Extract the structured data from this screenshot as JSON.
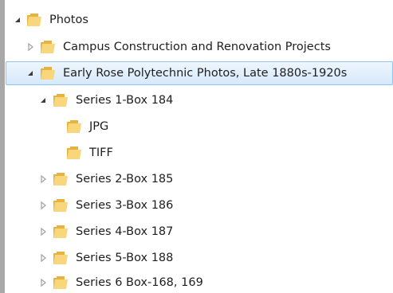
{
  "tree": {
    "rows": [
      {
        "label": "Photos",
        "toggle": "expanded",
        "icon": "folder-icon"
      },
      {
        "label": "Campus Construction and Renovation Projects",
        "toggle": "collapsed",
        "icon": "folder-icon"
      },
      {
        "label": "Early Rose Polytechnic Photos, Late 1880s-1920s",
        "toggle": "expanded",
        "icon": "folder-icon",
        "selected": true
      },
      {
        "label": "Series 1-Box 184",
        "toggle": "expanded",
        "icon": "folder-icon"
      },
      {
        "label": "JPG",
        "toggle": "none",
        "icon": "folder-icon"
      },
      {
        "label": "TIFF",
        "toggle": "none",
        "icon": "folder-icon"
      },
      {
        "label": "Series 2-Box 185",
        "toggle": "collapsed",
        "icon": "folder-icon"
      },
      {
        "label": "Series 3-Box 186",
        "toggle": "collapsed",
        "icon": "folder-icon"
      },
      {
        "label": "Series 4-Box 187",
        "toggle": "collapsed",
        "icon": "folder-icon"
      },
      {
        "label": "Series 5-Box 188",
        "toggle": "collapsed",
        "icon": "folder-icon"
      },
      {
        "label": "Series 6 Box-168, 169",
        "toggle": "collapsed",
        "icon": "folder-icon"
      }
    ]
  },
  "colors": {
    "selection_fill": "#d6e9fb",
    "selection_border": "#8fc3f0",
    "folder": "#f2c45a",
    "arrow_expanded": "#3c3c3c",
    "arrow_collapsed": "#a6a6a6"
  }
}
